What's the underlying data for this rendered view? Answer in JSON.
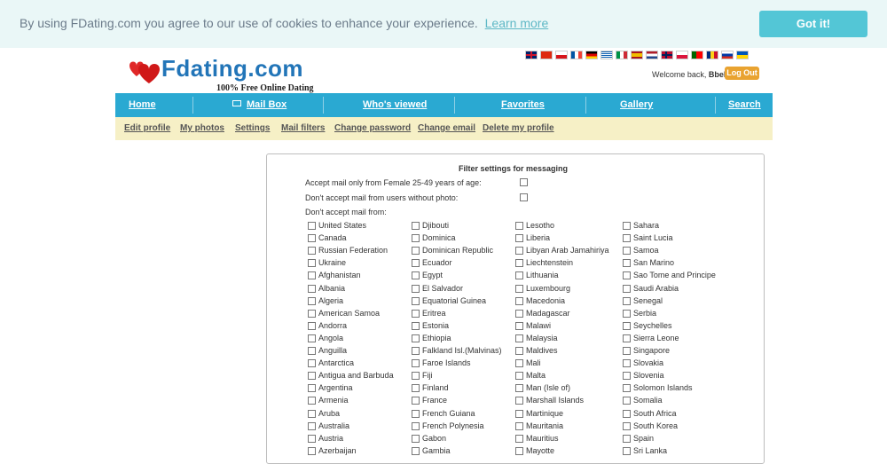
{
  "cookie": {
    "text": "By using FDating.com you agree to our use of cookies to enhance your experience.",
    "link": "Learn more",
    "button": "Got it!"
  },
  "logo": {
    "name": "Fdating.com",
    "tagline": "100% Free Online Dating"
  },
  "flags": [
    "uk",
    "china",
    "czech",
    "france",
    "germany",
    "greece",
    "italy",
    "spain",
    "netherlands",
    "norway",
    "poland",
    "portugal",
    "romania",
    "russia",
    "ukraine"
  ],
  "header": {
    "welcome_prefix": "Welcome back,",
    "username": "Bbell",
    "logout": "Log Out"
  },
  "mainnav": [
    "Home",
    "Mail Box",
    "Who's viewed",
    "Favorites",
    "Gallery",
    "Search"
  ],
  "subnav": [
    "Edit profile",
    "My photos",
    "Settings",
    "Mail filters",
    "Change password",
    "Change email",
    "Delete my profile"
  ],
  "filter": {
    "title": "Filter settings for messaging",
    "accept_only": "Accept mail only from Female 25-49 years of age:",
    "no_photo": "Don't accept mail from users without photo:",
    "dont_accept": "Don't accept mail from:"
  },
  "countries": [
    [
      "United States",
      "Canada",
      "Russian Federation",
      "Ukraine",
      "Afghanistan",
      "Albania",
      "Algeria",
      "American Samoa",
      "Andorra",
      "Angola",
      "Anguilla",
      "Antarctica",
      "Antigua and Barbuda",
      "Argentina",
      "Armenia",
      "Aruba",
      "Australia",
      "Austria",
      "Azerbaijan"
    ],
    [
      "Djibouti",
      "Dominica",
      "Dominican Republic",
      "Ecuador",
      "Egypt",
      "El Salvador",
      "Equatorial Guinea",
      "Eritrea",
      "Estonia",
      "Ethiopia",
      "Falkland Isl.(Malvinas)",
      "Faroe Islands",
      "Fiji",
      "Finland",
      "France",
      "French Guiana",
      "French Polynesia",
      "Gabon",
      "Gambia"
    ],
    [
      "Lesotho",
      "Liberia",
      "Libyan Arab Jamahiriya",
      "Liechtenstein",
      "Lithuania",
      "Luxembourg",
      "Macedonia",
      "Madagascar",
      "Malawi",
      "Malaysia",
      "Maldives",
      "Mali",
      "Malta",
      "Man (Isle of)",
      "Marshall Islands",
      "Martinique",
      "Mauritania",
      "Mauritius",
      "Mayotte"
    ],
    [
      "Sahara",
      "Saint Lucia",
      "Samoa",
      "San Marino",
      "Sao Tome and Principe",
      "Saudi Arabia",
      "Senegal",
      "Serbia",
      "Seychelles",
      "Sierra Leone",
      "Singapore",
      "Slovakia",
      "Slovenia",
      "Solomon Islands",
      "Somalia",
      "South Africa",
      "South Korea",
      "Spain",
      "Sri Lanka"
    ]
  ]
}
